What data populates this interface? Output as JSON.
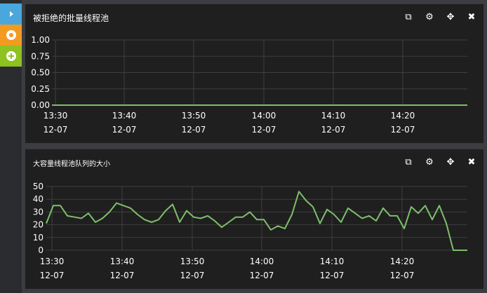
{
  "sidebar": {
    "buttons": [
      {
        "name": "expand",
        "icon": "play-icon",
        "color": "#49a7dd"
      },
      {
        "name": "settings",
        "icon": "gear-icon",
        "color": "#f39a21"
      },
      {
        "name": "add",
        "icon": "plus-circle-icon",
        "color": "#8dc21f"
      }
    ]
  },
  "panel_tools": {
    "copy": "⧉",
    "settings": "⚙",
    "move": "✥",
    "close": "✖"
  },
  "panels": [
    {
      "title": "被拒绝的批量线程池"
    },
    {
      "title": "大容量线程池队列的大小"
    }
  ],
  "colors": {
    "background": "#1f1f1f",
    "grid": "#3f3f3f",
    "line": "#7dbf6b",
    "text": "#ffffff"
  },
  "chart_data": [
    {
      "type": "line",
      "title": "被拒绝的批量线程池",
      "xlabel": "",
      "ylabel": "",
      "ylim": [
        0,
        1
      ],
      "yticks": [
        "1.00",
        "0.75",
        "0.50",
        "0.25",
        "0.00"
      ],
      "xtick_times": [
        "13:30",
        "13:40",
        "13:50",
        "14:00",
        "14:10",
        "14:20"
      ],
      "xtick_dates": [
        "12-07",
        "12-07",
        "12-07",
        "12-07",
        "12-07",
        "12-07"
      ],
      "series": [
        {
          "values": [
            0,
            0,
            0,
            0,
            0,
            0,
            0,
            0,
            0,
            0,
            0,
            0,
            0,
            0,
            0,
            0,
            0,
            0,
            0,
            0,
            0,
            0,
            0,
            0,
            0,
            0,
            0,
            0,
            0,
            0,
            0,
            0,
            0,
            0,
            0,
            0,
            0,
            0,
            0,
            0,
            0,
            0,
            0,
            0,
            0,
            0,
            0,
            0,
            0,
            0,
            0,
            0,
            0,
            0,
            0,
            0,
            0,
            0,
            0,
            0,
            0,
            0,
            0,
            0
          ]
        }
      ]
    },
    {
      "type": "line",
      "title": "大容量线程池队列的大小",
      "xlabel": "",
      "ylabel": "",
      "ylim": [
        0,
        50
      ],
      "yticks": [
        "50",
        "40",
        "30",
        "20",
        "10",
        "0"
      ],
      "xtick_times": [
        "13:30",
        "13:40",
        "13:50",
        "14:00",
        "14:10",
        "14:20"
      ],
      "xtick_dates": [
        "12-07",
        "12-07",
        "12-07",
        "12-07",
        "12-07",
        "12-07"
      ],
      "series": [
        {
          "values": [
            21,
            35,
            35,
            27,
            26,
            25,
            29,
            22,
            25,
            30,
            37,
            35,
            33,
            28,
            24,
            22,
            24,
            31,
            36,
            22,
            31,
            26,
            25,
            27,
            23,
            18,
            22,
            26,
            26,
            30,
            24,
            24,
            16,
            19,
            17,
            28,
            46,
            39,
            34,
            21,
            32,
            28,
            22,
            33,
            29,
            25,
            27,
            23,
            33,
            27,
            27,
            17,
            34,
            29,
            35,
            24,
            35,
            21,
            0,
            0,
            0
          ]
        }
      ]
    }
  ]
}
